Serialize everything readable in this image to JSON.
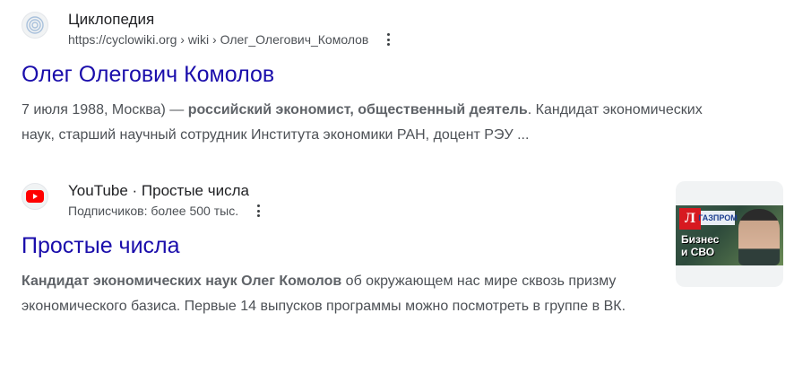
{
  "results": [
    {
      "site_name": "Циклопедия",
      "url": "https://cyclowiki.org › wiki › Олег_Олегович_Комолов",
      "favicon": "cyclowiki-icon",
      "title": "Олег Олегович Комолов",
      "snippet": {
        "pre": "7 июля 1988, Москва) — ",
        "bold": "российский экономист, общественный деятель",
        "post": ". Кандидат экономических наук, старший научный сотрудник Института экономики РАН, доцент РЭУ ..."
      }
    },
    {
      "site_name": "YouTube · Простые числа",
      "url": "Подписчиков: более 500 тыс.",
      "favicon": "youtube-icon",
      "title": "Простые числа",
      "snippet": {
        "bold": "Кандидат экономических наук Олег Комолов",
        "post": " об окружающем нас мире сквозь призму экономического базиса. Первые 14 выпусков программы можно посмотреть в группе в ВК."
      },
      "thumbnail": {
        "logo_letter": "Л",
        "logo_sub": "ГАЗПРОМ",
        "text_line1": "Бизнес",
        "text_line2": "и СВО"
      }
    }
  ],
  "colors": {
    "title_link": "#1a0dab",
    "snippet": "#4d5156",
    "youtube_red": "#ff0000"
  }
}
